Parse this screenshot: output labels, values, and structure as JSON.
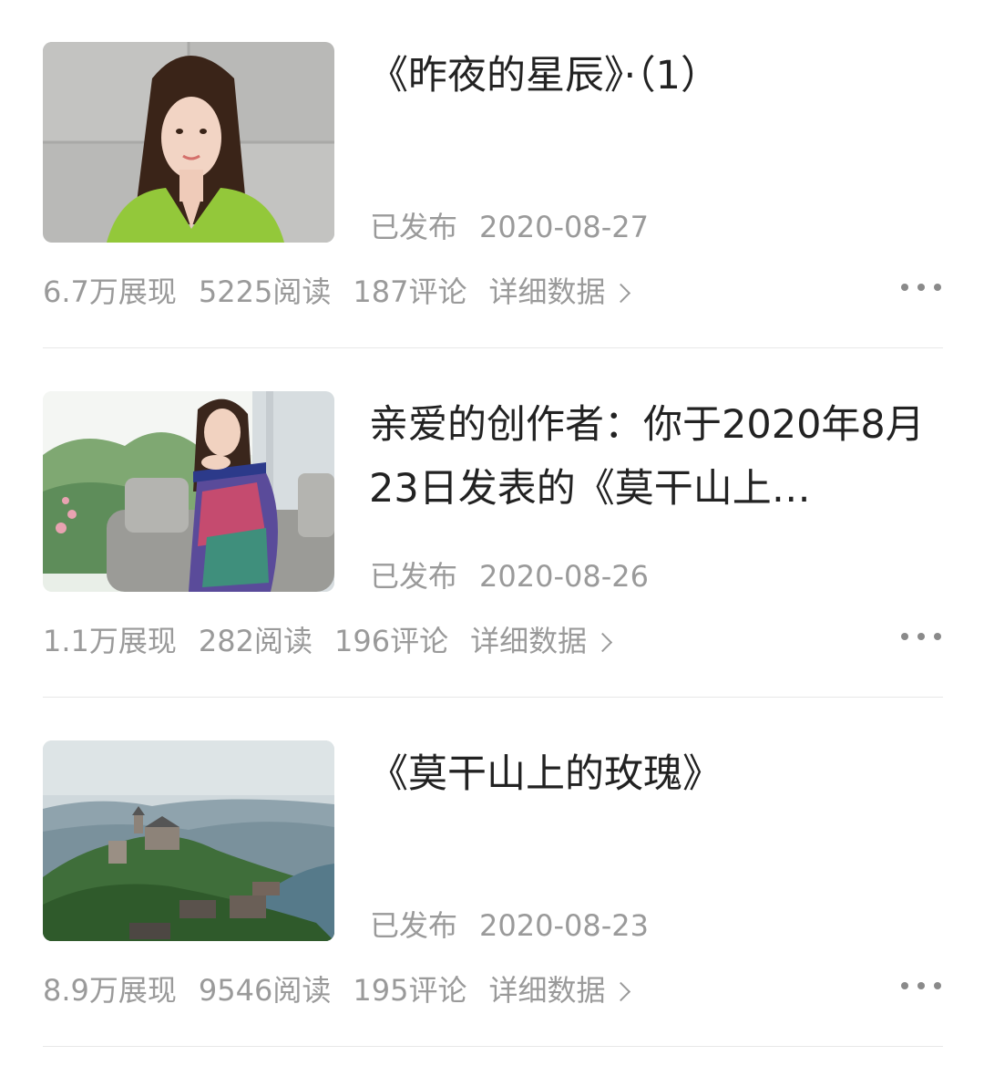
{
  "articles": [
    {
      "title": "《昨夜的星辰》·（1）",
      "status": "已发布",
      "date": "2020-08-27",
      "impressions": "6.7万展现",
      "reads": "5225阅读",
      "comments": "187评论",
      "detail_label": "详细数据",
      "thumb_icon": "portrait-woman-green-top-image"
    },
    {
      "title": "亲爱的创作者：你于2020年8月23日发表的《莫干山上…",
      "status": "已发布",
      "date": "2020-08-26",
      "impressions": "1.1万展现",
      "reads": "282阅读",
      "comments": "196评论",
      "detail_label": "详细数据",
      "thumb_icon": "woman-on-sofa-floral-dress-image"
    },
    {
      "title": "《莫干山上的玫瑰》",
      "status": "已发布",
      "date": "2020-08-23",
      "impressions": "8.9万展现",
      "reads": "9546阅读",
      "comments": "195评论",
      "detail_label": "详细数据",
      "thumb_icon": "mountain-castle-landscape-image"
    }
  ],
  "colors": {
    "title": "#222222",
    "meta": "#9a9a9a",
    "divider": "#e8e8e8"
  }
}
